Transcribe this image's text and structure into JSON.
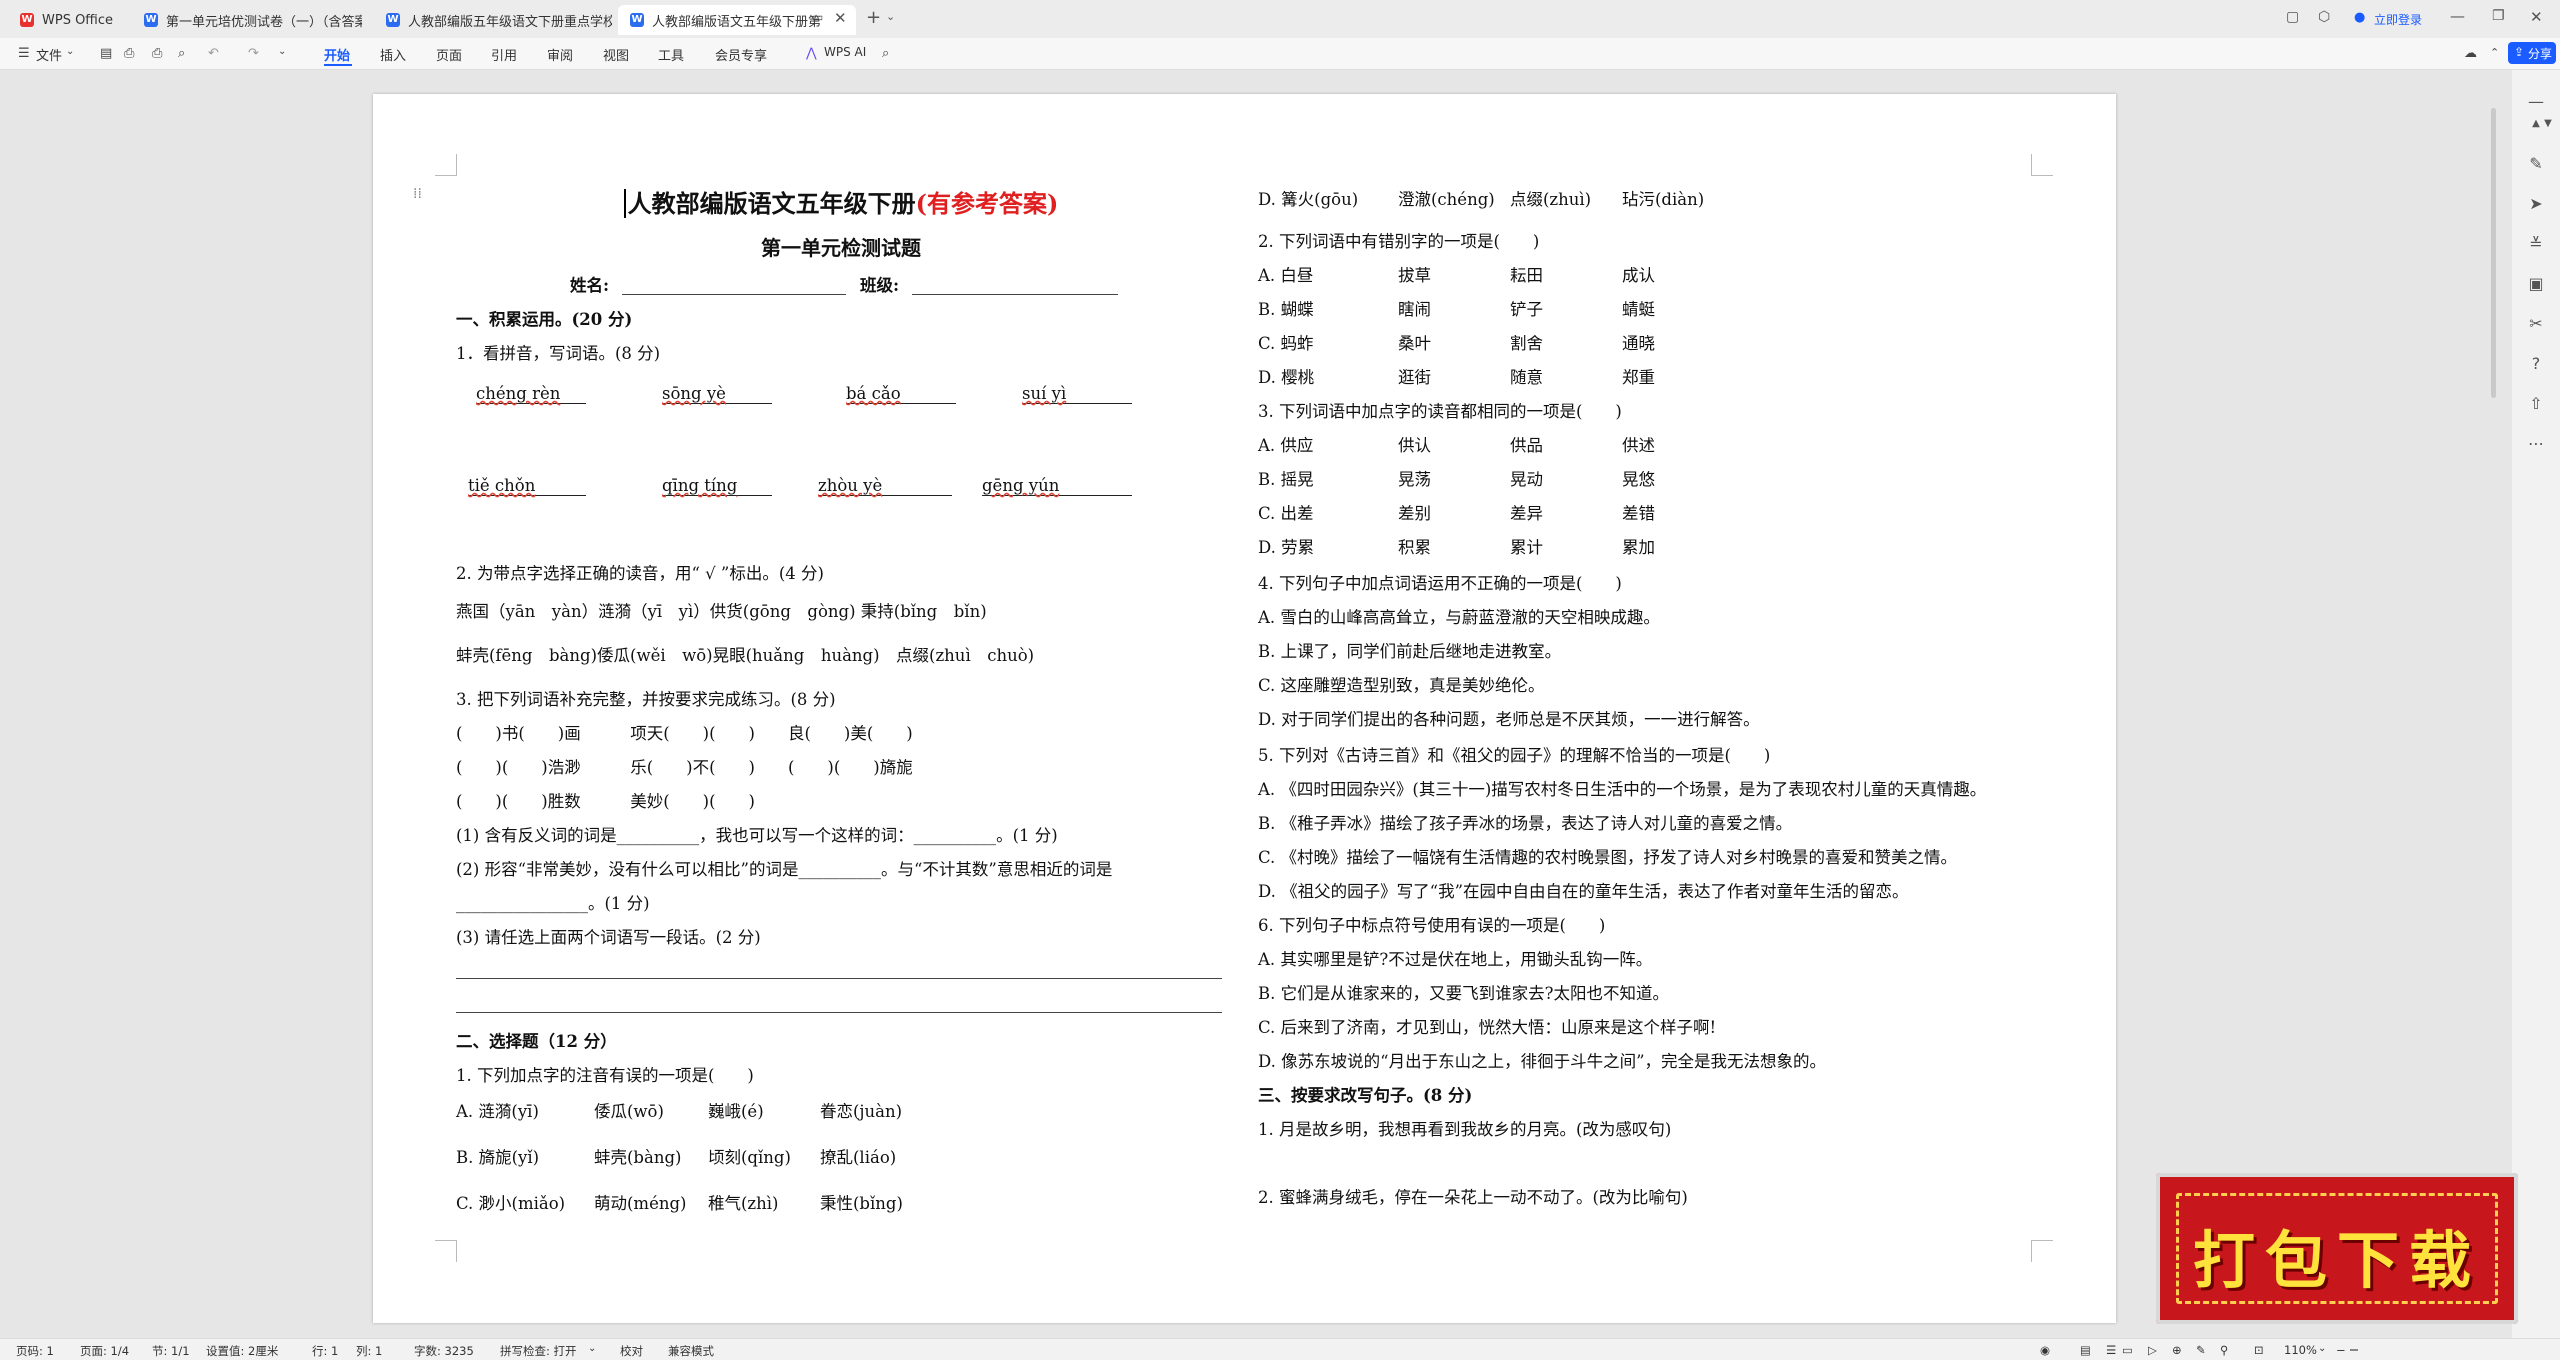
{
  "tabs": [
    {
      "label": "WPS Office",
      "icon": "wps-logo-icon",
      "color": "#e8312f"
    },
    {
      "label": "第一单元培优测试卷（一）（含答案）",
      "icon": "word-doc-icon",
      "color": "#2b6cf0"
    },
    {
      "label": "人教部编版五年级语文下册重点学校",
      "icon": "word-doc-icon",
      "color": "#2b6cf0"
    },
    {
      "label": "人教部编版语文五年级下册第",
      "icon": "word-doc-icon",
      "color": "#2b6cf0"
    }
  ],
  "header_right": {
    "login": "立即登录"
  },
  "menu": {
    "file": "文件",
    "items": [
      "开始",
      "插入",
      "页面",
      "引用",
      "审阅",
      "视图",
      "工具",
      "会员专享"
    ],
    "wps_ai": "WPS AI",
    "share": "分享"
  },
  "doc": {
    "title_black": "人教部编版语文五年级下册",
    "title_red": "(有参考答案)",
    "subtitle": "第一单元检测试题",
    "name_label": "姓名:",
    "class_label": "班级:",
    "s1": "一、积累运用。(20 分)",
    "q1": "1．看拼音，写词语。(8 分)",
    "pinyin_row1": [
      "chéng rèn",
      "sōng yè",
      "bá cǎo",
      "suí yì"
    ],
    "pinyin_row2": [
      "tiě chǒn",
      "qīng tíng",
      "zhòu yè",
      "gēng yún"
    ],
    "q2": "2. 为带点字选择正确的读音，用“ √ ”标出。(4 分)",
    "q2_line1": "燕国（yān　yàn）涟漪（yī　yì）供货(gōng　gòng) 秉持(bǐng　bǐn)",
    "q2_line2": "蚌壳(fēng　bàng)倭瓜(wěi　wō)晃眼(huǎng　huàng)　点缀(zhuì　chuò)",
    "q3": "3. 把下列词语补充完整，并按要求完成练习。(8 分)",
    "q3_line1": "(　　)书(　　)画　　　项天(　　)(　　)　　良(　　)美(　　)",
    "q3_line2": "(　　)(　　)浩渺　　　乐(　　)不(　　)　　(　　)(　　)旖旎",
    "q3_line3": "(　　)(　　)胜数　　　美妙(　　)(　　)",
    "q3_sub1": "(1) 含有反义词的词是__________，我也可以写一个这样的词：__________。(1 分)",
    "q3_sub2": "(2) 形容“非常美妙，没有什么可以相比”的词是__________。与“不计其数”意思相近的词是",
    "q3_sub2b": "________________。(1 分)",
    "q3_sub3": "(3) 请任选上面两个词语写一段话。(2 分)",
    "s2": "二、选择题（12 分）",
    "c1": "1. 下列加点字的注音有误的一项是(　　)",
    "c1_A": [
      "A. 涟漪(yī)",
      "倭瓜(wō)",
      "巍峨(é)",
      "眷恋(juàn)"
    ],
    "c1_B": [
      "B. 旖旎(yǐ)",
      "蚌壳(bàng)",
      "顷刻(qǐng)",
      "撩乱(liáo)"
    ],
    "c1_C": [
      "C. 渺小(miǎo)",
      "萌动(méng)",
      "稚气(zhì)",
      "秉性(bǐng)"
    ],
    "c1_D": [
      "D. 篝火(gōu)",
      "澄澈(chéng)",
      "点缀(zhuì)",
      "玷污(diàn)"
    ],
    "c2": "2. 下列词语中有错别字的一项是(　　)",
    "c2_opts": [
      [
        "A. 白昼",
        "拔草",
        "耘田",
        "成认"
      ],
      [
        "B. 蝴蝶",
        "瞎闹",
        "铲子",
        "蜻蜓"
      ],
      [
        "C. 蚂蚱",
        "桑叶",
        "割舍",
        "通晓"
      ],
      [
        "D. 樱桃",
        "逛街",
        "随意",
        "郑重"
      ]
    ],
    "c3": "3. 下列词语中加点字的读音都相同的一项是(　　)",
    "c3_opts": [
      [
        "A. 供应",
        "供认",
        "供品",
        "供述"
      ],
      [
        "B. 摇晃",
        "晃荡",
        "晃动",
        "晃悠"
      ],
      [
        "C. 出差",
        "差别",
        "差异",
        "差错"
      ],
      [
        "D. 劳累",
        "积累",
        "累计",
        "累加"
      ]
    ],
    "c4": "4. 下列句子中加点词语运用不正确的一项是(　　)",
    "c4_opts": [
      "A. 雪白的山峰高高耸立，与蔚蓝澄澈的天空相映成趣。",
      "B. 上课了，同学们前赴后继地走进教室。",
      "C. 这座雕塑造型别致，真是美妙绝伦。",
      "D. 对于同学们提出的各种问题，老师总是不厌其烦，一一进行解答。"
    ],
    "c5": "5. 下列对《古诗三首》和《祖父的园子》的理解不恰当的一项是(　　)",
    "c5_opts": [
      "A. 《四时田园杂兴》(其三十一)描写农村冬日生活中的一个场景，是为了表现农村儿童的天真情趣。",
      "B. 《稚子弄冰》描绘了孩子弄冰的场景，表达了诗人对儿童的喜爱之情。",
      "C. 《村晚》描绘了一幅饶有生活情趣的农村晚景图，抒发了诗人对乡村晚景的喜爱和赞美之情。",
      "D. 《祖父的园子》写了“我”在园中自由自在的童年生活，表达了作者对童年生活的留恋。"
    ],
    "c6": "6. 下列句子中标点符号使用有误的一项是(　　)",
    "c6_opts": [
      "A. 其实哪里是铲?不过是伏在地上，用锄头乱钩一阵。",
      "B. 它们是从谁家来的，又要飞到谁家去?太阳也不知道。",
      "C. 后来到了济南，才见到山，恍然大悟：山原来是这个样子啊!",
      "D. 像苏东坡说的“月出于东山之上，徘徊于斗牛之间”，完全是我无法想象的。"
    ],
    "s3": "三、按要求改写句子。(8 分)",
    "r1": "1. 月是故乡明，我想再看到我故乡的月亮。(改为感叹句)",
    "r2": "2. 蜜蜂满身绒毛，停在一朵花上一动不动了。(改为比喻句)"
  },
  "status": {
    "page": "页码: 1",
    "pages": "页面: 1/4",
    "section": "节: 1/1",
    "setting": "设置值: 2厘米",
    "row": "行: 1",
    "col": "列: 1",
    "words": "字数: 3235",
    "spell": "拼写检查: 打开",
    "proof": "校对",
    "compat": "兼容模式",
    "zoom": "110%"
  },
  "promo": {
    "text": "打包下载"
  }
}
